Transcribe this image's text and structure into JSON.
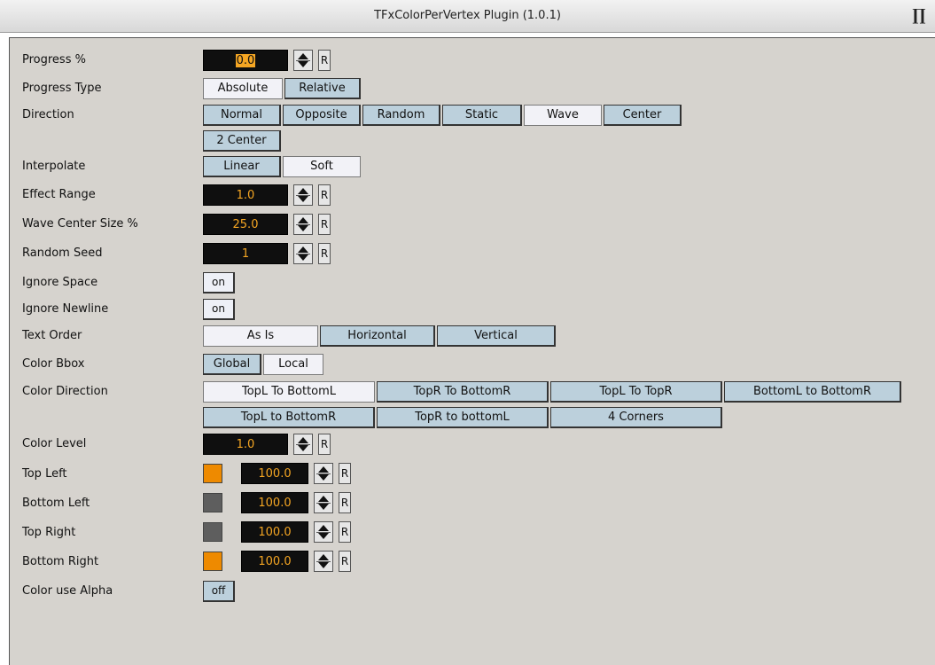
{
  "window": {
    "title": "TFxColorPerVertex Plugin (1.0.1)",
    "icon": "plugin-logo-icon"
  },
  "fields": {
    "progress": {
      "label": "Progress %",
      "value": "0.0",
      "reset": "R"
    },
    "progress_type": {
      "label": "Progress Type",
      "options": [
        "Absolute",
        "Relative"
      ],
      "selected": "Absolute"
    },
    "direction": {
      "label": "Direction",
      "options": [
        "Normal",
        "Opposite",
        "Random",
        "Static",
        "Wave",
        "Center",
        "2 Center"
      ],
      "selected": "Wave"
    },
    "interpolate": {
      "label": "Interpolate",
      "options": [
        "Linear",
        "Soft"
      ],
      "selected": "Soft"
    },
    "effect_range": {
      "label": "Effect Range",
      "value": "1.0",
      "reset": "R"
    },
    "wave_center_size": {
      "label": "Wave Center Size %",
      "value": "25.0",
      "reset": "R"
    },
    "random_seed": {
      "label": "Random Seed",
      "value": "1",
      "reset": "R"
    },
    "ignore_space": {
      "label": "Ignore Space",
      "value": "on"
    },
    "ignore_newline": {
      "label": "Ignore Newline",
      "value": "on"
    },
    "text_order": {
      "label": "Text Order",
      "options": [
        "As Is",
        "Horizontal",
        "Vertical"
      ],
      "selected": "As Is"
    },
    "color_bbox": {
      "label": "Color Bbox",
      "options": [
        "Global",
        "Local"
      ],
      "selected": "Local"
    },
    "color_direction": {
      "label": "Color Direction",
      "options": [
        "TopL To BottomL",
        "TopR To BottomR",
        "TopL To TopR",
        "BottomL to BottomR",
        "TopL to BottomR",
        "TopR to bottomL",
        "4 Corners"
      ],
      "selected": "TopL To BottomL"
    },
    "color_level": {
      "label": "Color Level",
      "value": "1.0",
      "reset": "R"
    },
    "top_left": {
      "label": "Top Left",
      "color": "#ee8a00",
      "value": "100.0",
      "reset": "R"
    },
    "bottom_left": {
      "label": "Bottom Left",
      "color": "#5e5e5e",
      "value": "100.0",
      "reset": "R"
    },
    "top_right": {
      "label": "Top Right",
      "color": "#5e5e5e",
      "value": "100.0",
      "reset": "R"
    },
    "bottom_right": {
      "label": "Bottom Right",
      "color": "#ee8a00",
      "value": "100.0",
      "reset": "R"
    },
    "color_use_alpha": {
      "label": "Color use Alpha",
      "value": "off"
    }
  },
  "colors": {
    "panel": "#d6d3ce",
    "button": "#bcd0dc",
    "selected": "#f2f2f7",
    "numeric_bg": "#0f0f0f",
    "numeric_text": "#f5a623"
  }
}
